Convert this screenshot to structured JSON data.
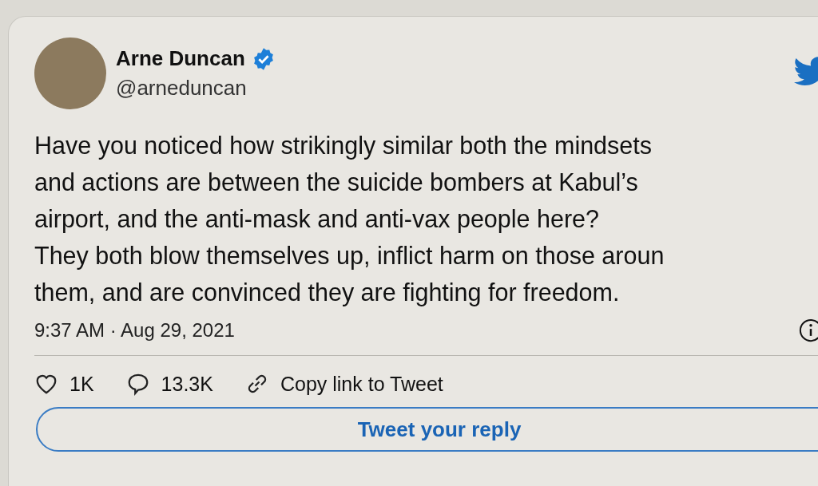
{
  "author": {
    "name": "Arne Duncan",
    "handle": "@arneduncan",
    "verified": true
  },
  "tweet_lines": [
    "Have you noticed how strikingly similar both the mindsets",
    "and actions are between the suicide bombers at Kabul’s",
    "airport, and the anti-mask and anti-vax people here?",
    "They both blow themselves up, inflict harm on those aroun",
    "them, and are convinced they are fighting for freedom."
  ],
  "timestamp": "9:37 AM · Aug 29, 2021",
  "actions": [
    {
      "kind": "like",
      "label": "1K"
    },
    {
      "kind": "reply",
      "label": "13.3K"
    },
    {
      "kind": "link",
      "label": "Copy link to Tweet"
    }
  ],
  "reply_button": "Tweet your reply"
}
